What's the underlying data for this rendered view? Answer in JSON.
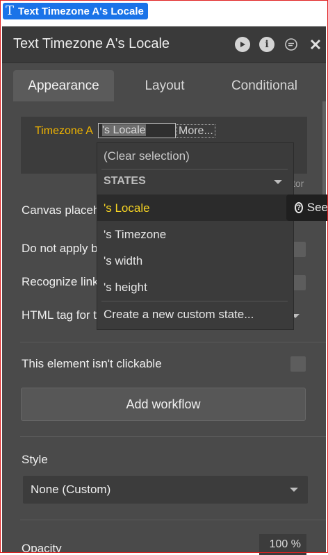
{
  "element_chip": {
    "label": "Text Timezone A's Locale",
    "icon": "text-T-icon"
  },
  "panel": {
    "title": "Text Timezone A's Locale",
    "header_icons": [
      "play-icon",
      "info-icon",
      "comment-icon",
      "close-icon"
    ]
  },
  "tabs": [
    {
      "label": "Appearance",
      "active": true
    },
    {
      "label": "Layout",
      "active": false
    },
    {
      "label": "Conditional",
      "active": false
    }
  ],
  "expression": {
    "prefix": "Timezone A",
    "input_value": "'s Locale",
    "more_label": "More..."
  },
  "editor_hint": "tor",
  "properties": {
    "canvas_placeholder": "Canvas placeh",
    "do_not_apply": "Do not apply b",
    "recognize_links": "Recognize link",
    "html_tag": "HTML tag for t",
    "not_clickable": "This element isn't clickable",
    "add_workflow": "Add workflow",
    "style_label": "Style",
    "style_value": "None (Custom)",
    "opacity_label": "Opacity",
    "opacity_value": "100 %"
  },
  "dropdown": {
    "clear": "(Clear selection)",
    "section": "STATES",
    "items": [
      "'s Locale",
      "'s Timezone",
      "'s width",
      "'s height"
    ],
    "create": "Create a new custom state..."
  },
  "tooltip": {
    "label": "See"
  },
  "colors": {
    "accent": "#1a73e8",
    "expression": "#f0b400",
    "highlight_text": "#f5d323"
  }
}
